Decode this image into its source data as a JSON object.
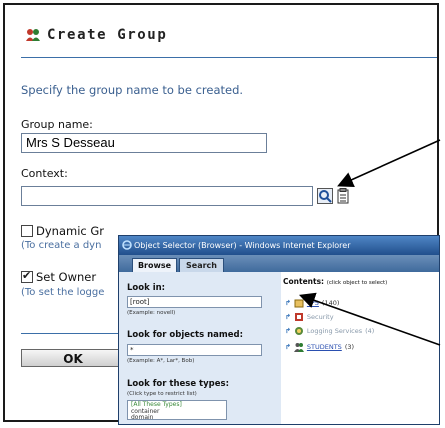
{
  "page": {
    "title": "Create Group",
    "description": "Specify the group name to be created.",
    "group_name_label": "Group name:",
    "group_name_value": "Mrs S Desseau",
    "context_label": "Context:",
    "context_value": "",
    "dynamic_group_label": "Dynamic Gr",
    "dynamic_group_hint": "(To create a dyn",
    "set_owner_label": "Set Owner",
    "set_owner_hint": "(To set the logge",
    "ok_label": "OK"
  },
  "popup": {
    "window_title": "Object Selector (Browser) - Windows Internet Explorer",
    "tabs": [
      "Browse",
      "Search"
    ],
    "look_in_label": "Look in:",
    "look_in_value": "[root]",
    "look_in_example": "(Example: novell)",
    "named_label": "Look for objects named:",
    "named_value": "*",
    "named_example": "(Example: A*, Lar*, Bob)",
    "types_label": "Look for these types:",
    "types_hint": "(Click type to restrict list)",
    "types_list": [
      "[All These Types]",
      "container",
      "domain"
    ],
    "contents_label": "Contents:",
    "contents_hint": "(click object to select)",
    "items": [
      {
        "name": "TPS",
        "count": "(140)"
      },
      {
        "name": "Security",
        "count": ""
      },
      {
        "name": "Logging Services",
        "count": "(4)"
      },
      {
        "name": "STUDENTS",
        "count": "(3)"
      }
    ]
  },
  "colors": {
    "title_accent": "#3b6fa8",
    "popup_titlebar": "#2a5a98",
    "link": "#2a4fb0"
  }
}
